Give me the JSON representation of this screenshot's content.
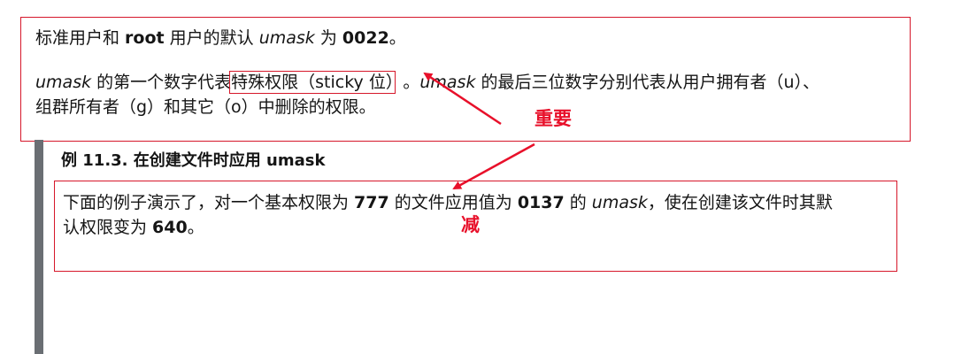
{
  "p1": {
    "t1": "标准用户和 ",
    "b1": "root",
    "t2": " 用户的默认 ",
    "i1": "umask",
    "t3": " 为 ",
    "b2": "0022",
    "t4": "。"
  },
  "p2": {
    "i1": "umask",
    "t1": " 的第一个数字代表",
    "boxed": "特殊权限（sticky 位）",
    "t2": "。",
    "i2": "umask",
    "t3": " 的最后三位数字分别代表从用户拥有者（u）、",
    "line2": "组群所有者（g）和其它（o）中删除的权限。"
  },
  "example": {
    "title": "例 11.3. 在创建文件时应用 umask",
    "t1": "下面的例子演示了，对一个基本权限为 ",
    "b1": "777",
    "t2": " 的文件应用值为 ",
    "b2": "0137",
    "t3": " 的 ",
    "i1": "umask",
    "t4": "，使在创建该文件时其默",
    "t5": "认权限变为 ",
    "b3": "640",
    "t6": "。"
  },
  "annotations": {
    "important": "重要",
    "subtract": "减"
  },
  "colors": {
    "annotation_red": "#e8102a",
    "sidebar_gray": "#6a6e73"
  }
}
